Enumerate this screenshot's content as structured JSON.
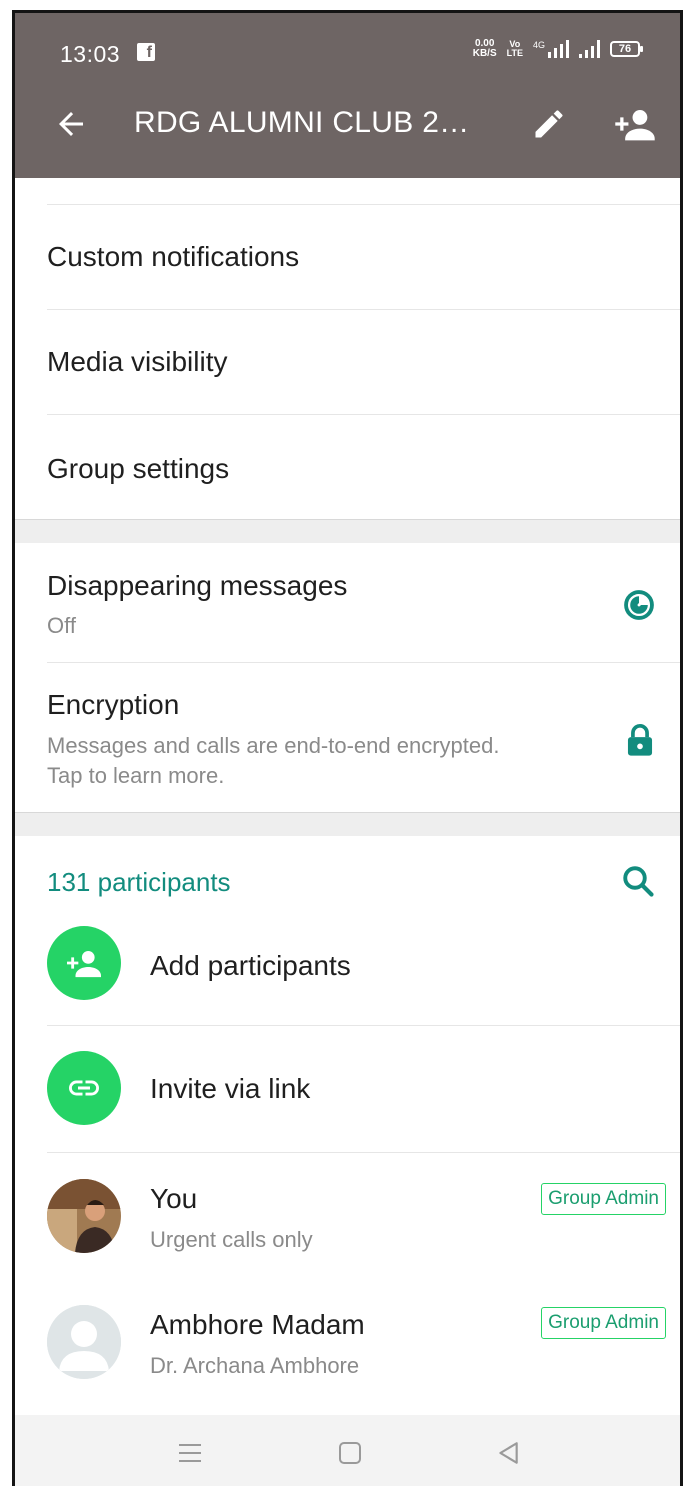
{
  "status_bar": {
    "time": "13:03",
    "net_speed_value": "0.00",
    "net_speed_unit": "KB/S",
    "volte_top": "Vo",
    "volte_bottom": "LTE",
    "network_type": "4G",
    "battery": "76",
    "icons": [
      "facebook-icon",
      "signal-icon",
      "battery-icon"
    ]
  },
  "app_bar": {
    "title": "RDG ALUMNI CLUB 2…",
    "icons": [
      "back-arrow-icon",
      "edit-icon",
      "add-person-icon"
    ]
  },
  "settings": {
    "custom_notifications": "Custom notifications",
    "media_visibility": "Media visibility",
    "group_settings": "Group settings"
  },
  "privacy": {
    "disappearing_title": "Disappearing messages",
    "disappearing_value": "Off",
    "encryption_title": "Encryption",
    "encryption_line1": "Messages and calls are end-to-end encrypted.",
    "encryption_line2": "Tap to learn more."
  },
  "participants": {
    "count_label": "131 participants",
    "add_label": "Add participants",
    "invite_label": "Invite via link",
    "members": [
      {
        "name": "You",
        "status": "Urgent calls only",
        "badge": "Group Admin"
      },
      {
        "name": "Ambhore Madam",
        "status": "Dr. Archana Ambhore",
        "badge": "Group Admin"
      }
    ]
  },
  "colors": {
    "app_bar": "#6e6564",
    "accent_teal": "#128c7e",
    "accent_green": "#25d366"
  }
}
